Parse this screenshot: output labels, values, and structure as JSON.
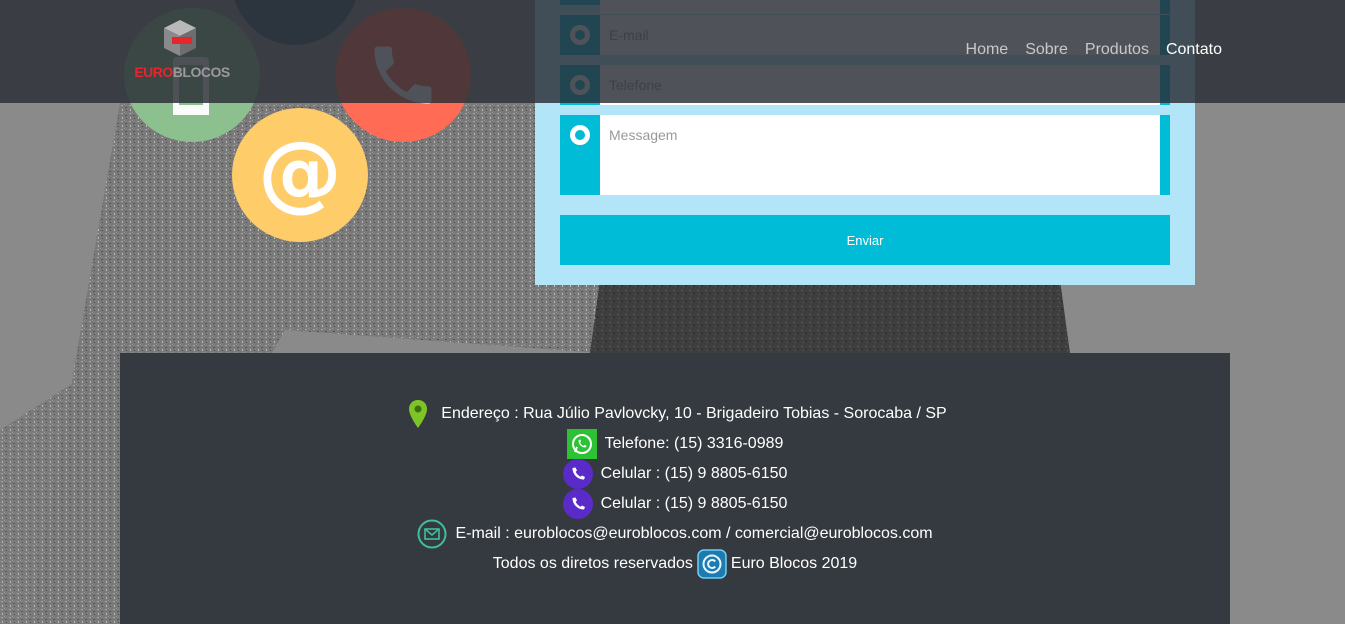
{
  "header": {
    "logo": {
      "part1": "EURO",
      "part2": "BLOCOS"
    },
    "nav": [
      {
        "label": "Home"
      },
      {
        "label": "Sobre"
      },
      {
        "label": "Produtos"
      },
      {
        "label": "Contato"
      }
    ],
    "active_nav": "Contato"
  },
  "form": {
    "email_placeholder": "E-mail",
    "phone_placeholder": "Telefone",
    "message_placeholder": "Messagem",
    "submit_label": "Enviar"
  },
  "footer": {
    "address": "Endereço : Rua Júlio Pavlovcky, 10 - Brigadeiro Tobias - Sorocaba / SP",
    "phone": "Telefone: (15) 3316-0989",
    "mobile1": "Celular : (15) 9 8805-6150",
    "mobile2": "Celular : (15) 9 8805-6150",
    "email": "E-mail : euroblocos@euroblocos.com / comercial@euroblocos.com",
    "rights_prefix": "Todos os diretos reservados",
    "rights_suffix": "Euro Blocos 2019"
  },
  "colors": {
    "accent": "#00bcd6",
    "form_bg": "#b3e5f8",
    "footer_bg": "#353a40",
    "header_bg": "#282c34",
    "circle_green": "#8cc08e",
    "circle_red": "#ff6b55",
    "circle_yellow": "#fecd6a"
  },
  "icons": {
    "address": "map-pin-icon",
    "phone": "whatsapp-icon",
    "mobile": "phone-icon",
    "email": "envelope-icon",
    "rights": "copyright-icon"
  }
}
